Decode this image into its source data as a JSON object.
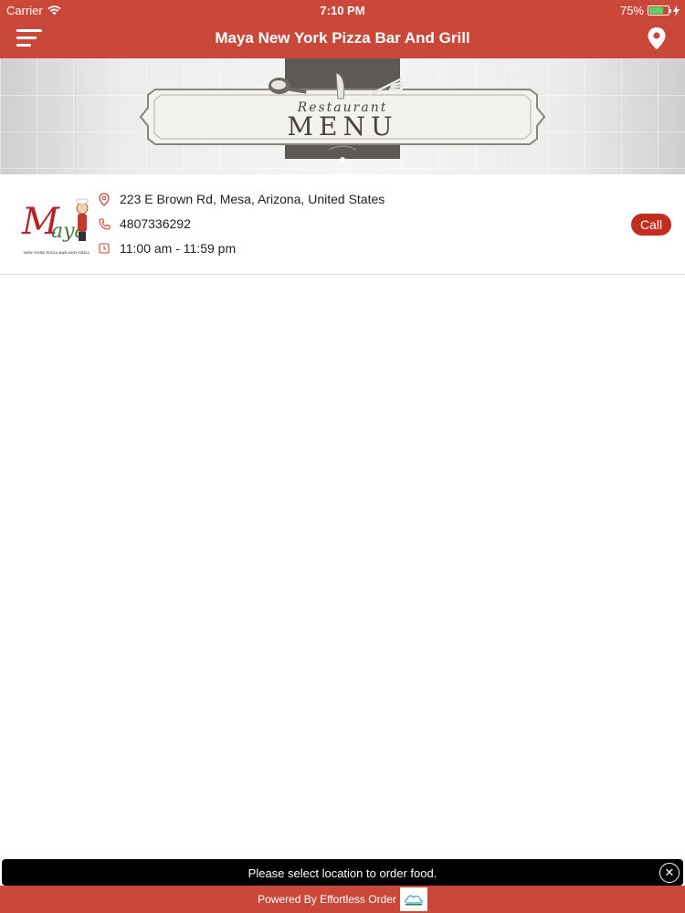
{
  "status_bar": {
    "carrier": "Carrier",
    "time": "7:10 PM",
    "battery": "75%",
    "battery_level": 0.75
  },
  "header": {
    "title": "Maya New York Pizza Bar And Grill",
    "menu_icon": "hamburger-menu-icon",
    "location_icon": "map-pin-icon"
  },
  "banner": {
    "small_text": "Restaurant",
    "big_text": "MENU"
  },
  "restaurant": {
    "logo_text": "Maya",
    "logo_subtext": "NEW YORK PIZZA BAR AND GRILL",
    "address": "223 E Brown Rd, Mesa, Arizona, United States",
    "phone": "4807336292",
    "hours": "11:00 am - 11:59 pm",
    "call_label": "Call"
  },
  "toast": {
    "message": "Please select location to order food.",
    "close_icon": "close-icon"
  },
  "footer": {
    "text": "Powered By Effortless Order"
  },
  "colors": {
    "brand_red": "#c9483a",
    "call_red": "#c32c1f",
    "battery_green": "#4cd964"
  }
}
